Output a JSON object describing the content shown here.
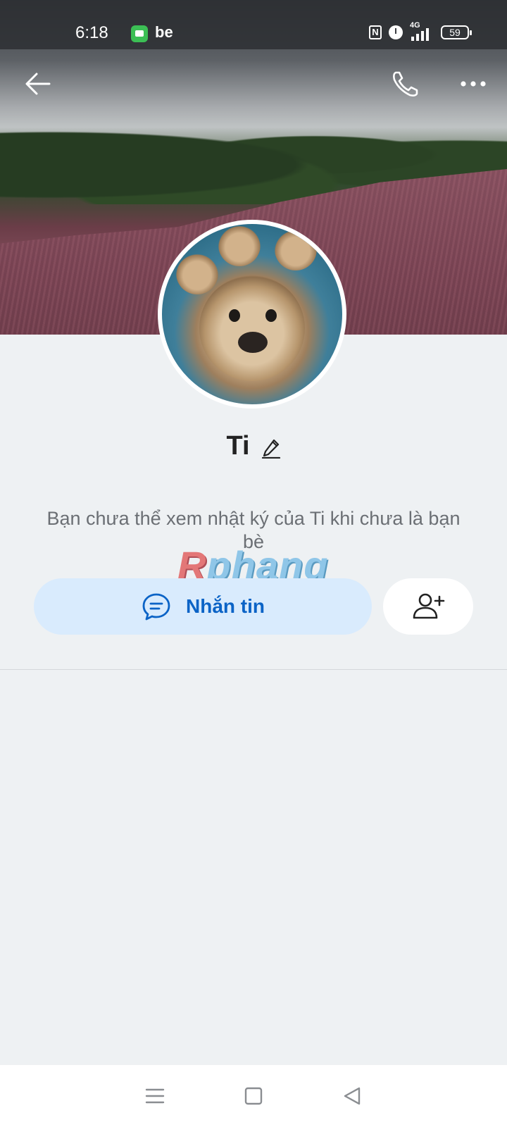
{
  "status_bar": {
    "time": "6:18",
    "app_icons": [
      "messages-icon",
      "be-icon"
    ],
    "be_label": "be",
    "network": "4G",
    "battery": "59"
  },
  "header": {
    "icons": [
      "back-arrow-icon",
      "phone-icon",
      "more-dots-icon"
    ]
  },
  "profile": {
    "name": "Ti",
    "notice": "Bạn chưa thể xem nhật ký của Ti khi chưa là bạn bè"
  },
  "actions": {
    "message_label": "Nhắn tin",
    "add_friend_icon": "add-friend-icon"
  },
  "watermark": {
    "first": "R",
    "rest": "phang"
  },
  "navbar": {
    "icons": [
      "menu-icon",
      "home-square-icon",
      "back-triangle-icon"
    ]
  },
  "colors": {
    "accent": "#0b63c6",
    "message_button_bg": "#d9ebfd",
    "page_bg": "#eef1f3"
  }
}
